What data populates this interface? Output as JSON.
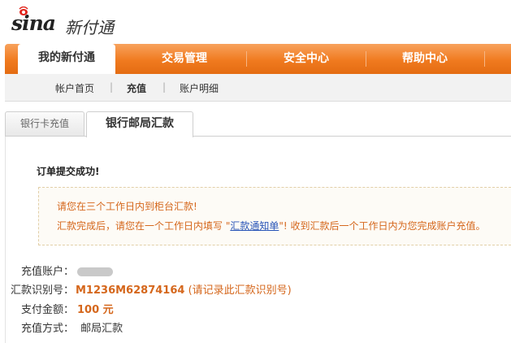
{
  "logo": {
    "brand": "sina",
    "product": "新付通"
  },
  "main_nav": {
    "tabs": [
      {
        "label": "我的新付通",
        "active": true
      },
      {
        "label": "交易管理",
        "active": false
      },
      {
        "label": "安全中心",
        "active": false
      },
      {
        "label": "帮助中心",
        "active": false
      }
    ]
  },
  "sub_nav": {
    "items": [
      {
        "label": "帐户首页",
        "active": false
      },
      {
        "label": "充值",
        "active": true
      },
      {
        "label": "账户明细",
        "active": false
      }
    ],
    "separator": "|"
  },
  "method_tabs": [
    {
      "label": "银行卡充值",
      "active": false
    },
    {
      "label": "银行邮局汇款",
      "active": true
    }
  ],
  "order": {
    "success_message": "订单提交成功!",
    "notice_line1": "请您在三个工作日内到柜台汇款!",
    "notice_line2_before": "汇款完成后，请您在一个工作日内填写 \"",
    "notice_link": "汇款通知单",
    "notice_line2_after": "\"! 收到汇款后一个工作日内为您完成账户充值。",
    "fields": {
      "account_label": "充值账户：",
      "code_label": "汇款识别号：",
      "code_value": "M1236M62874164",
      "code_note": "(请记录此汇款识别号)",
      "amount_label": "支付金额：",
      "amount_value": "100 元",
      "method_label": "充值方式：",
      "method_value": "邮局汇款"
    }
  },
  "colors": {
    "nav_orange": "#f07a1f",
    "accent_text": "#d5671c",
    "link_blue": "#2a56b8"
  }
}
